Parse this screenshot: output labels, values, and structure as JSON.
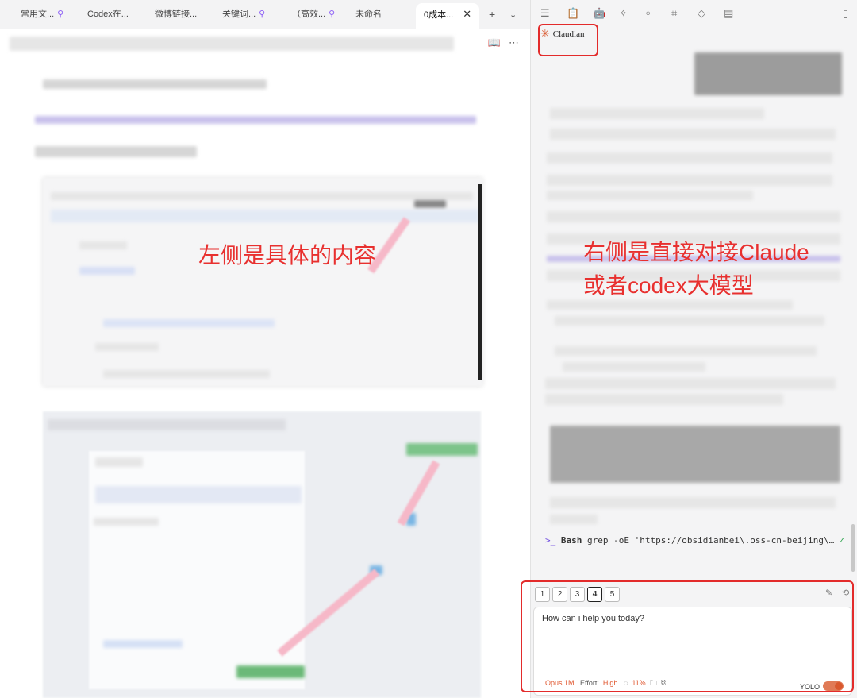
{
  "tabs": [
    {
      "label": "常用文...",
      "pinned": true
    },
    {
      "label": "Codex在...",
      "pinned": false
    },
    {
      "label": "微博链接...",
      "pinned": false
    },
    {
      "label": "关键词...",
      "pinned": true
    },
    {
      "label": "（高效...",
      "pinned": true
    },
    {
      "label": "未命名",
      "pinned": false
    },
    {
      "label": "0成本...",
      "pinned": false,
      "active": true
    }
  ],
  "icons": {
    "pin": "pin-icon",
    "close": "close-icon",
    "new_tab": "plus-icon",
    "tab_menu": "chevron-down-icon",
    "reading_view": "book-icon",
    "more": "more-icon",
    "right_toolbar": [
      "list-icon",
      "clipboard-icon",
      "bot-icon",
      "wand-icon",
      "tag-edit-icon",
      "tags-icon",
      "label-icon",
      "archive-icon"
    ],
    "sidebar_toggle": "sidebar-toggle-icon",
    "new_chat": "edit-icon",
    "history": "history-icon",
    "context": "context-icon",
    "folder": "folder-icon",
    "attach": "link-icon"
  },
  "annotations": {
    "left": "左侧是具体的内容",
    "right_line1": "右侧是直接对接Claude",
    "right_line2": "或者codex大模型"
  },
  "plugin": {
    "name": "Claudian"
  },
  "bash_line": {
    "prompt": ">_",
    "keyword": "Bash",
    "command": "grep -oE 'https://obsidianbei\\.oss-cn-beijing\\…",
    "status": "✓"
  },
  "modes": [
    "1",
    "2",
    "3",
    "4",
    "5"
  ],
  "active_mode": "4",
  "input": {
    "placeholder": "How can i help you today?"
  },
  "footer": {
    "model": "Opus 1M",
    "effort_label": "Effort:",
    "effort_value": "High",
    "context_pct": "11%",
    "yolo_label": "YOLO",
    "yolo_on": true
  },
  "colors": {
    "annotation": "#e8302f",
    "accent": "#d9582e",
    "bash_prompt": "#6d49e0",
    "success": "#2da44e"
  }
}
